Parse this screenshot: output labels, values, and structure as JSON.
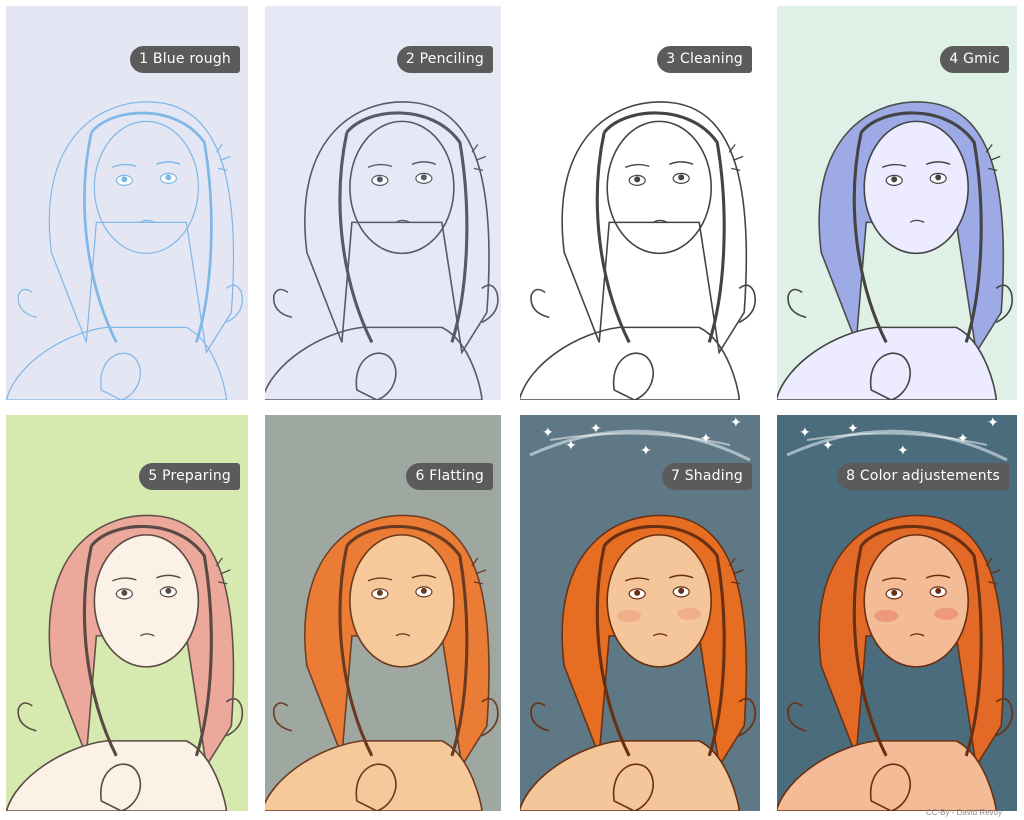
{
  "panels": [
    {
      "step": "1 Blue rough",
      "bg": "#e4e6f4",
      "line": "#7fb7e6",
      "hair": "none",
      "skin": "none",
      "stage": "rough"
    },
    {
      "step": "2 Penciling",
      "bg": "#e7e8f5",
      "line": "#555a66",
      "hair": "none",
      "skin": "none",
      "stage": "pencil"
    },
    {
      "step": "3 Cleaning",
      "bg": "#ffffff",
      "line": "#444444",
      "hair": "none",
      "skin": "none",
      "stage": "clean"
    },
    {
      "step": "4 Gmic",
      "bg": "#dff1e6",
      "line": "#444444",
      "hair": "#9aa7e6",
      "skin": "#ecebff",
      "stage": "gmic"
    },
    {
      "step": "5 Preparing",
      "bg": "#d6eab0",
      "line": "#5a4a44",
      "hair": "#eea59a",
      "skin": "#fbf1e6",
      "stage": "prep"
    },
    {
      "step": "6 Flatting",
      "bg": "#9ea8a0",
      "line": "#6a3a20",
      "hair": "#f07a30",
      "skin": "#f6c89a",
      "stage": "flat"
    },
    {
      "step": "7 Shading",
      "bg": "#5e7886",
      "line": "#6a2e10",
      "hair": "#ee6e1e",
      "skin": "#f4c69a",
      "stage": "shade"
    },
    {
      "step": "8 Color adjustements",
      "bg": "#4b6c7c",
      "line": "#6a2e10",
      "hair": "#ec6a22",
      "skin": "#f4bc96",
      "stage": "adjust"
    }
  ],
  "credit": "CC-By - David Revoy"
}
